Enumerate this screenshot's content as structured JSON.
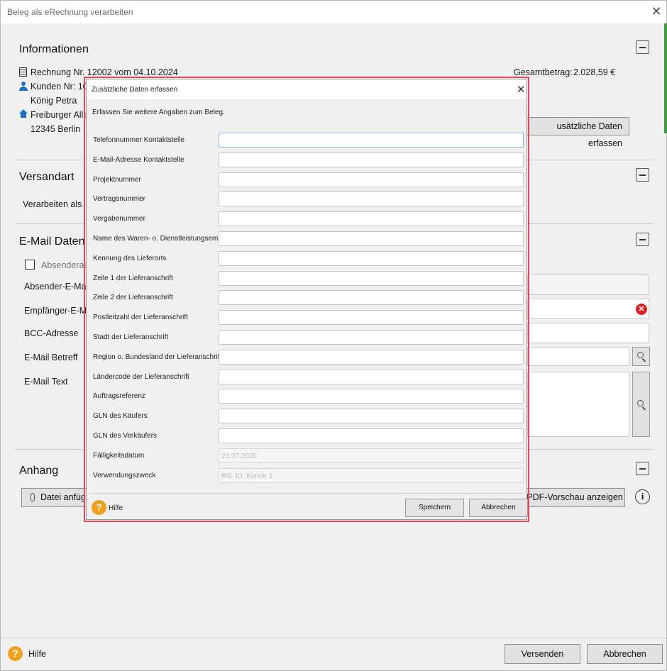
{
  "window": {
    "title": "Beleg als eRechnung verarbeiten",
    "close": "✕"
  },
  "info": {
    "title": "Informationen",
    "invoice": "Rechnung Nr. 12002 vom 04.10.2024",
    "customer": "Kunden Nr: 10",
    "name": "König Petra",
    "street": "Freiburger Alle",
    "city": "12345 Berlin",
    "total_label": "Gesamtbetrag:",
    "total_value": "2.028,59 €",
    "extra_button": "Zusätzliche Daten erfassen",
    "extra_button_visible": "usätzliche Daten erfassen"
  },
  "shipping": {
    "title": "Versandart",
    "process_as": "Verarbeiten als"
  },
  "email": {
    "title": "E-Mail Daten",
    "checkbox_label": "Absenderad",
    "sender": "Absender-E-Mai",
    "recipient": "Empfänger-E-M",
    "bcc": "BCC-Adresse",
    "subject": "E-Mail Betreff",
    "text": "E-Mail Text"
  },
  "attachment": {
    "title": "Anhang",
    "attach_button": "Datei anfüg",
    "preview_button": "PDF-Vorschau anzeigen"
  },
  "footer": {
    "help": "Hilfe",
    "send": "Versenden",
    "cancel": "Abbrechen"
  },
  "dialog": {
    "title": "Zusätzliche Daten erfassen",
    "close": "✕",
    "subtitle": "Erfassen Sie weitere Angaben zum Beleg.",
    "fields": [
      {
        "label": "Telefonnummer Kontaktstelle",
        "value": ""
      },
      {
        "label": "E-Mail-Adresse Kontaktstelle",
        "value": ""
      },
      {
        "label": "Projektnummer",
        "value": ""
      },
      {
        "label": "Vertragsnummer",
        "value": ""
      },
      {
        "label": "Vergabenummer",
        "value": ""
      },
      {
        "label": "Name des Waren- o. Dienstleistungsempf.",
        "value": ""
      },
      {
        "label": "Kennung des Lieferorts",
        "value": ""
      },
      {
        "label": "Zeile 1 der Lieferanschrift",
        "value": ""
      },
      {
        "label": "Zeile 2 der Lieferanschrift",
        "value": ""
      },
      {
        "label": "Postleitzahl der Lieferanschrift",
        "value": ""
      },
      {
        "label": "Stadt der Lieferanschrift",
        "value": ""
      },
      {
        "label": "Region o. Bundesland der Lieferanschrift",
        "value": ""
      },
      {
        "label": "Ländercode der Lieferanschrift",
        "value": ""
      },
      {
        "label": "Auftragsreferenz",
        "value": ""
      },
      {
        "label": "GLN des Käufers",
        "value": ""
      },
      {
        "label": "GLN des Verkäufers",
        "value": ""
      },
      {
        "label": "Fälligkeitsdatum",
        "value": "23.07.2025"
      },
      {
        "label": "Verwendungszweck",
        "value": "RG-10, Kunde 1"
      }
    ],
    "help": "Hilfe",
    "save": "Speichern",
    "cancel": "Abbrechen"
  },
  "colors": {
    "highlight": "#e04b55",
    "help": "#f0a020",
    "error": "#d9222a",
    "accent": "#1e6fc1"
  }
}
